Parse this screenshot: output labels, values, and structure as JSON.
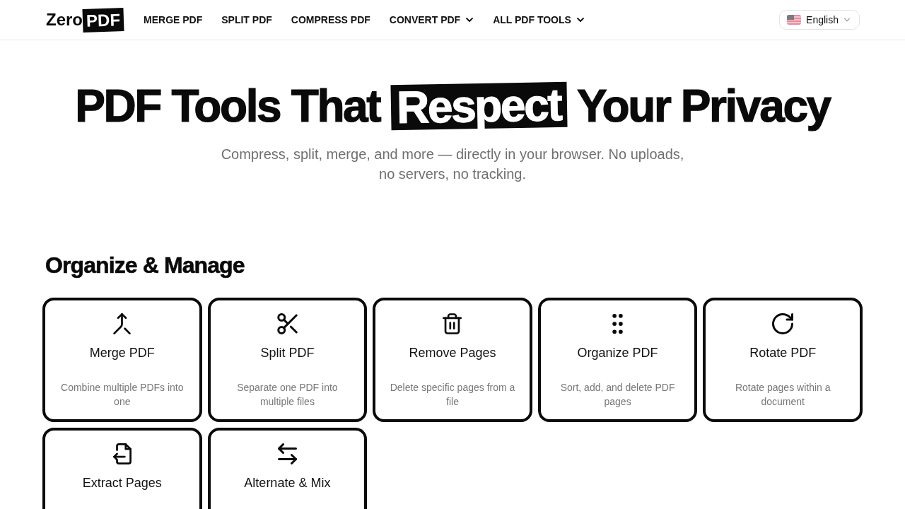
{
  "header": {
    "logo": {
      "text": "Zero",
      "badge": "PDF"
    },
    "nav": [
      {
        "label": "MERGE PDF",
        "has_menu": false
      },
      {
        "label": "SPLIT PDF",
        "has_menu": false
      },
      {
        "label": "COMPRESS PDF",
        "has_menu": false
      },
      {
        "label": "CONVERT PDF",
        "has_menu": true
      },
      {
        "label": "ALL PDF TOOLS",
        "has_menu": true
      }
    ],
    "language": {
      "label": "English"
    }
  },
  "hero": {
    "title": {
      "before": "PDF Tools That",
      "highlight": "Respect",
      "after": "Your Privacy"
    },
    "subtitle": "Compress, split, merge, and more — directly in your browser. No uploads, no servers, no tracking."
  },
  "sections": [
    {
      "heading": "Organize & Manage",
      "tools": [
        {
          "kind": "merge",
          "title": "Merge PDF",
          "description": "Combine multiple PDFs into one"
        },
        {
          "kind": "split",
          "title": "Split PDF",
          "description": "Separate one PDF into multiple files"
        },
        {
          "kind": "remove",
          "title": "Remove Pages",
          "description": "Delete specific pages from a file"
        },
        {
          "kind": "organize",
          "title": "Organize PDF",
          "description": "Sort, add, and delete PDF pages"
        },
        {
          "kind": "rotate",
          "title": "Rotate PDF",
          "description": "Rotate pages within a document"
        },
        {
          "kind": "extract",
          "title": "Extract Pages"
        },
        {
          "kind": "alternate",
          "title": "Alternate & Mix"
        }
      ]
    }
  ]
}
